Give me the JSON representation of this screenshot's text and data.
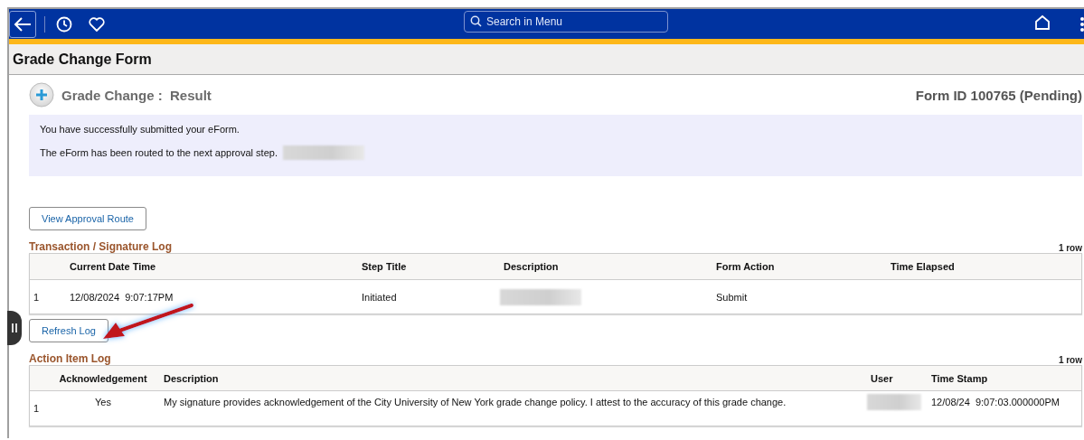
{
  "header": {
    "search": {
      "placeholder": "Search in Menu"
    }
  },
  "page_title": "Grade Change Form",
  "section": {
    "title": "Grade Change :  Result",
    "form_id": "Form ID 100765 (Pending)"
  },
  "messages": [
    {
      "text": "You have successfully submitted your eForm."
    },
    {
      "text": "The eForm has been routed to the next approval step.",
      "redacted": true
    }
  ],
  "view_route_button": "View Approval Route",
  "transaction_log": {
    "title": "Transaction / Signature Log",
    "count": "1 row",
    "columns": [
      "",
      "Current Date Time",
      "Step Title",
      "Description",
      "Form Action",
      "Time Elapsed"
    ],
    "rows": [
      [
        {
          "kind": "text",
          "text": "1"
        },
        {
          "kind": "text",
          "text": "12/08/2024  9:07:17PM"
        },
        {
          "kind": "text",
          "text": "Initiated"
        },
        {
          "kind": "redacted"
        },
        {
          "kind": "text",
          "text": "Submit"
        },
        {
          "kind": "empty"
        }
      ]
    ]
  },
  "refresh_button": "Refresh Log",
  "action_log": {
    "title": "Action Item Log",
    "count": "1 row",
    "columns": [
      "",
      "Acknowledgement",
      "Description",
      "User",
      "Time Stamp"
    ],
    "rows": [
      [
        {
          "kind": "text",
          "text": "1"
        },
        {
          "kind": "text",
          "text": "Yes"
        },
        {
          "kind": "text",
          "text": "My signature provides acknowledgement of the City University of New York grade change policy. I attest to the accuracy of this grade change."
        },
        {
          "kind": "redacted"
        },
        {
          "kind": "text",
          "text": "12/08/24  9:07:03.000000PM"
        }
      ]
    ]
  }
}
